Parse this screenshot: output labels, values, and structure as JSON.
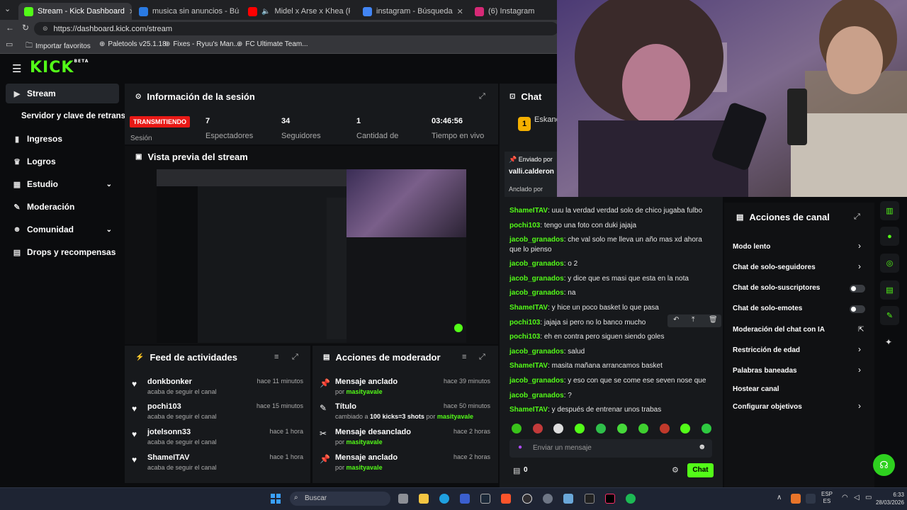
{
  "browser": {
    "tabs": [
      {
        "title": "Stream - Kick Dashboard",
        "active": true
      },
      {
        "title": "musica sin anuncios - Búsqueda"
      },
      {
        "title": "Midel x Arse x Khea (Ft. Duki)"
      },
      {
        "title": "instagram - Búsqueda"
      },
      {
        "title": "(6) Instagram"
      }
    ],
    "url": "https://dashboard.kick.com/stream",
    "bookmarks": [
      "Importar favoritos",
      "Paletools v25.1.18",
      "Fixes - Ryuu's Man...",
      "FC Ultimate Team..."
    ]
  },
  "kick": {
    "logo": "KICK",
    "logo_sup": "BETA"
  },
  "sidebar": {
    "items": [
      {
        "label": "Stream",
        "icon": "play-icon"
      },
      {
        "label": "Servidor y clave de retransn",
        "icon": ""
      },
      {
        "label": "Ingresos",
        "icon": "bars-icon"
      },
      {
        "label": "Logros",
        "icon": "trophy-icon"
      },
      {
        "label": "Estudio",
        "icon": "grid-icon"
      },
      {
        "label": "Moderación",
        "icon": "wrench-icon"
      },
      {
        "label": "Comunidad",
        "icon": "users-icon"
      },
      {
        "label": "Drops y recompensas",
        "icon": "gift-icon"
      }
    ]
  },
  "session": {
    "title": "Información de la sesión",
    "live_badge": "TRANSMITIENDO",
    "session_label": "Sesión",
    "stats": [
      {
        "value": "7",
        "label": "Espectadores"
      },
      {
        "value": "34",
        "label": "Seguidores"
      },
      {
        "value": "1",
        "label": "Cantidad de"
      },
      {
        "value": "03:46:56",
        "label": "Tiempo en vivo"
      }
    ]
  },
  "preview": {
    "title": "Vista previa del stream"
  },
  "feed": {
    "title": "Feed de actividades",
    "items": [
      {
        "name": "donkbonker",
        "sub": "acaba de seguir el canal",
        "time": "hace 11 minutos"
      },
      {
        "name": "pochi103",
        "sub": "acaba de seguir el canal",
        "time": "hace 15 minutos"
      },
      {
        "name": "jotelsonn33",
        "sub": "acaba de seguir el canal",
        "time": "hace 1 hora"
      },
      {
        "name": "ShameITAV",
        "sub": "acaba de seguir el canal",
        "time": "hace 1 hora"
      }
    ]
  },
  "modactions": {
    "title": "Acciones de moderador",
    "items": [
      {
        "name": "Mensaje anclado",
        "sub": "por",
        "user": "masityavale",
        "time": "hace 39 minutos"
      },
      {
        "name": "Título",
        "sub": "cambiado a",
        "detail": "100 kicks=3 shots",
        "sub2": "por",
        "user": "masityavale",
        "time": "hace 50 minutos"
      },
      {
        "name": "Mensaje desanclado",
        "sub": "por",
        "user": "masityavale",
        "time": "hace 2 horas"
      },
      {
        "name": "Mensaje anclado",
        "sub": "por",
        "user": "masityavale",
        "time": "hace 2 horas"
      }
    ]
  },
  "chat": {
    "title": "Chat",
    "pinned_user": "Eskano",
    "pinned_badge": "1",
    "pinned_by_label": "Enviado por",
    "pinned_sender": "valli.calderon",
    "anchored_by_label": "Anclado por",
    "messages": [
      {
        "user": "ShameITAV",
        "text": "uuu la verdad verdad solo de chico jugaba fulbo"
      },
      {
        "user": "pochi103",
        "text": "tengo una foto con duki jajaja"
      },
      {
        "user": "jacob_granados",
        "text": "che val solo me lleva un año mas xd ahora que lo pienso"
      },
      {
        "user": "jacob_granados",
        "text": "o 2"
      },
      {
        "user": "jacob_granados",
        "text": "y dice que es masi que esta en la nota"
      },
      {
        "user": "jacob_granados",
        "text": "na"
      },
      {
        "user": "ShameITAV",
        "text": "y hice un poco basket lo que pasa"
      },
      {
        "user": "pochi103",
        "text": "jajaja si pero no lo banco mucho"
      },
      {
        "user": "pochi103",
        "text": "eh en contra pero siguen siendo goles"
      },
      {
        "user": "jacob_granados",
        "text": "salud"
      },
      {
        "user": "ShameITAV",
        "text": "masita mañana arrancamos basket"
      },
      {
        "user": "jacob_granados",
        "text": "y eso con que se come ese seven nose que"
      },
      {
        "user": "jacob_granados",
        "text": "?"
      },
      {
        "user": "ShameITAV",
        "text": "y después de entrenar unos trabas"
      }
    ],
    "input_placeholder": "Enviar un mensaje",
    "points": "0",
    "send_label": "Chat"
  },
  "canal": {
    "title": "Acciones de canal",
    "rows": [
      {
        "label": "Modo lento",
        "control": "chevron"
      },
      {
        "label": "Chat de solo-seguidores",
        "control": "chevron"
      },
      {
        "label": "Chat de solo-suscriptores",
        "control": "toggle"
      },
      {
        "label": "Chat de solo-emotes",
        "control": "toggle"
      },
      {
        "label": "Moderación del chat con IA",
        "control": "external"
      },
      {
        "label": "Restricción de edad",
        "control": "chevron"
      },
      {
        "label": "Palabras baneadas",
        "control": "chevron"
      },
      {
        "label": "Hostear canal",
        "control": "none"
      },
      {
        "label": "Configurar objetivos",
        "control": "chevron"
      }
    ]
  },
  "taskbar": {
    "search_placeholder": "Buscar",
    "lang": "ESP",
    "lang2": "ES",
    "time": "6:33",
    "date": "28/03/2026"
  },
  "colors": {
    "accent": "#53fc18",
    "live": "#e91916",
    "panel": "#17191c"
  }
}
